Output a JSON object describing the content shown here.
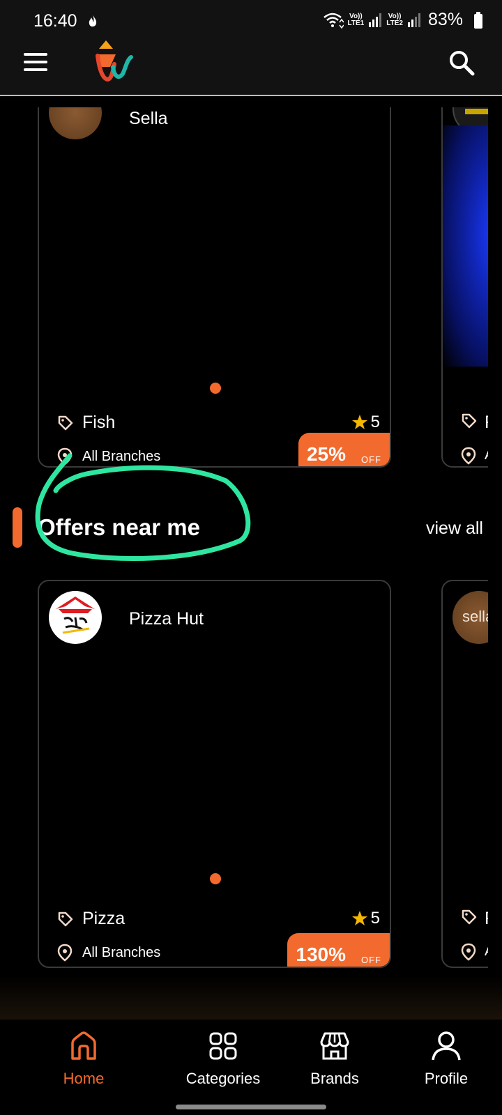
{
  "status_bar": {
    "time": "16:40",
    "net1_top": "Vo))",
    "net1_bottom": "LTE1",
    "net2_top": "Vo))",
    "net2_bottom": "LTE2",
    "battery": "83%",
    "icons": [
      "flame-icon",
      "wifi-icon",
      "signal-icon",
      "battery-icon"
    ]
  },
  "header": {
    "icons": [
      "menu-icon",
      "app-logo",
      "search-icon"
    ]
  },
  "first_section": {
    "main_card": {
      "brand_name": "Sella",
      "category": "Fish",
      "rating": "5",
      "branches": "All Branches",
      "discount": "25%",
      "off_label": "OFF"
    },
    "side_card": {
      "category": "F",
      "branches": "A"
    }
  },
  "offers_section": {
    "title": "Offers near me",
    "view_all": "view all",
    "main_card": {
      "brand_name": "Pizza Hut",
      "category": "Pizza",
      "rating": "5",
      "branches": "All Branches",
      "discount": "130%",
      "off_label": "OFF"
    },
    "side_card": {
      "logo_text": "sella",
      "category": "F",
      "branches": "A"
    }
  },
  "bottom_nav": {
    "items": [
      {
        "label": "Home",
        "icon": "home-icon",
        "active": true
      },
      {
        "label": "Categories",
        "icon": "grid-icon",
        "active": false
      },
      {
        "label": "Brands",
        "icon": "store-icon",
        "active": false
      },
      {
        "label": "Profile",
        "icon": "user-icon",
        "active": false
      }
    ]
  },
  "colors": {
    "accent": "#f26a2e",
    "background": "#000000",
    "star": "#f5b800",
    "annotation": "#2ee6a0"
  }
}
